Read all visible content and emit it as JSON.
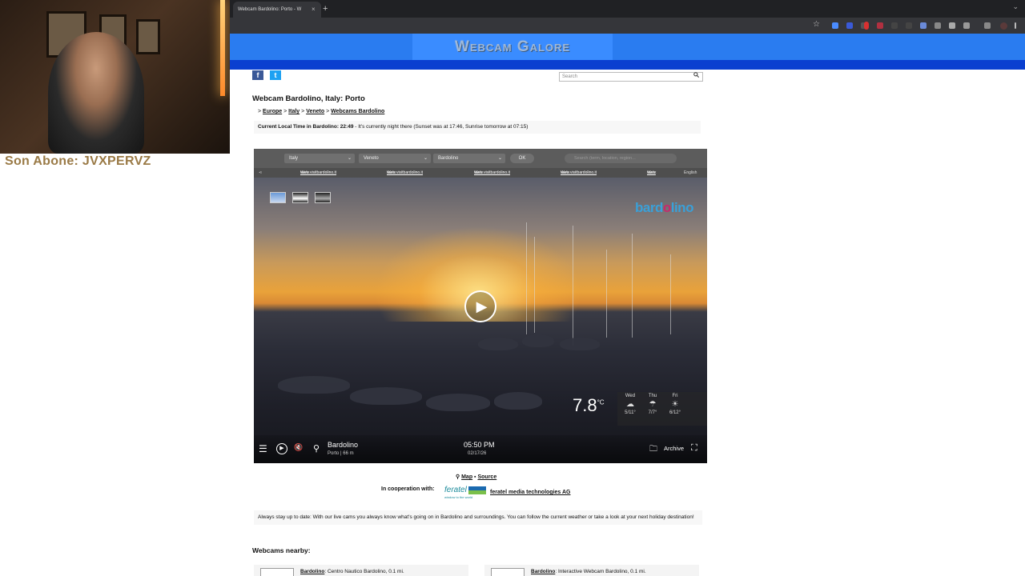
{
  "streamer": {
    "overlay_text": "Son Abone: JVXPERVZ"
  },
  "browser": {
    "tab_title": "Webcam Bardolino: Porto - W",
    "tab_close": "×",
    "new_tab": "+",
    "tab_menu": "⌄",
    "bookmark_star": "☆"
  },
  "site": {
    "logo": "Webcam Galore",
    "social": {
      "facebook": "f",
      "twitter": "t"
    },
    "search_placeholder": "Search"
  },
  "page": {
    "title": "Webcam Bardolino, Italy: Porto",
    "breadcrumb": {
      "prefix": ">",
      "items": [
        "Europe",
        "Italy",
        "Veneto",
        "Webcams Bardolino"
      ],
      "sep": ">"
    },
    "local_time_label": "Current Local Time in Bardolino: 22:49",
    "local_time_note": "- It's currently night there (Sunset was at 17:46, Sunrise tomorrow at 07:15)"
  },
  "player": {
    "selectors": {
      "country": "Italy",
      "region": "Veneto",
      "place": "Bardolino",
      "ok": "OK",
      "search_placeholder": "Search (term, location, region..."
    },
    "web_prefix": "Web:",
    "web_links": [
      "www.visitbardolino.it",
      "www.visitbardolino.it",
      "www.visitbardolino.it",
      "www.visitbardolino.it",
      "www"
    ],
    "language": "English",
    "brand_logo_a": "bard",
    "brand_logo_o": "o",
    "brand_logo_b": "lino",
    "temperature": "7.8",
    "temperature_unit": "°C",
    "forecast": [
      {
        "day": "Wed",
        "icon": "☁",
        "range": "5/11°"
      },
      {
        "day": "Thu",
        "icon": "☂",
        "range": "7/7°"
      },
      {
        "day": "Fri",
        "icon": "☀",
        "range": "6/12°"
      }
    ],
    "location_name": "Bardolino",
    "location_sub": "Porto | 66 m",
    "time": "05:50 PM",
    "date": "02/17/26",
    "archive": "Archive"
  },
  "below": {
    "map": "Map",
    "source": "Source",
    "coop_label": "In cooperation with:",
    "feratel_name": "feratel",
    "feratel_tagline": "window to the world",
    "feratel_link": "feratel media technologies AG",
    "description": "Always stay up to date: With our live cams you always know what's going on in Bardolino and surroundings. You can follow the current weather or take a look at your next holiday destination!",
    "nearby_heading": "Webcams nearby:",
    "nearby": [
      {
        "name": "Bardolino",
        "detail": ": Centro Nautico Bardolino, 0.1 mi."
      },
      {
        "name": "Bardolino",
        "detail": ": Interactive Webcam Bardolino, 0.1 mi."
      }
    ]
  },
  "colors": {
    "header": "#2a7cf0",
    "header_band": "#0a3fd0",
    "facebook": "#3b5998",
    "twitter": "#1da1f2"
  }
}
